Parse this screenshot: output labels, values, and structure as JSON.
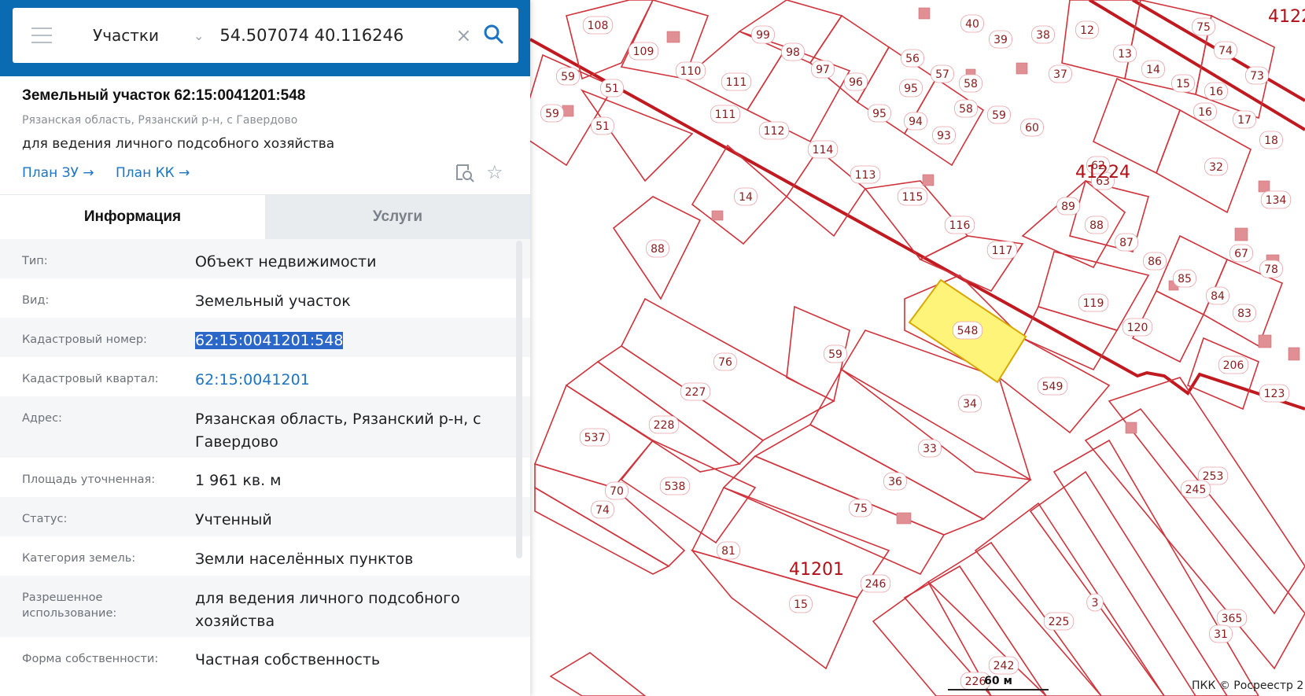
{
  "search": {
    "layer": "Участки",
    "coords": "54.507074 40.116246"
  },
  "card": {
    "title": "Земельный участок 62:15:0041201:548",
    "address": "Рязанская область, Рязанский р-н, с Гавердово",
    "purpose": "для ведения личного подсобного хозяйства",
    "plan_zu": "План ЗУ",
    "plan_kk": "План КК"
  },
  "tabs": [
    {
      "label": "Информация"
    },
    {
      "label": "Услуги"
    }
  ],
  "rows": [
    {
      "label": "Тип:",
      "value": "Объект недвижимости"
    },
    {
      "label": "Вид:",
      "value": "Земельный участок"
    },
    {
      "label": "Кадастровый номер:",
      "value": "62:15:0041201:548"
    },
    {
      "label": "Кадастровый квартал:",
      "value": "62:15:0041201"
    },
    {
      "label": "Адрес:",
      "value": "Рязанская область, Рязанский р-н, с Гавердово"
    },
    {
      "label": "Площадь уточненная:",
      "value": "1 961 кв. м"
    },
    {
      "label": "Статус:",
      "value": "Учтенный"
    },
    {
      "label": "Категория земель:",
      "value": "Земли населённых пунктов"
    },
    {
      "label": "Разрешенное использование:",
      "value": "для ведения личного подсобного хозяйства"
    },
    {
      "label": "Форма собственности:",
      "value": "Частная собственность"
    }
  ],
  "map": {
    "quarters": [
      "41224",
      "41201",
      "4122"
    ],
    "scale": "60 м",
    "copyright": "ПКК © Росреестр 2",
    "selected_parcel": "548",
    "colors": {
      "parcel": "#d0333b",
      "selected_fill": "#fff47a",
      "header": "#0a6ab2"
    }
  }
}
